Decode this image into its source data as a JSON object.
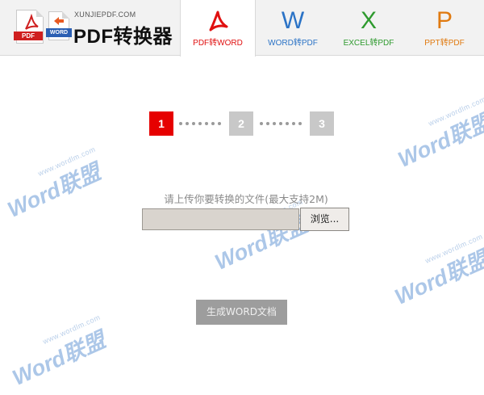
{
  "logo": {
    "small_text": "XUNJIEPDF.COM",
    "title": "PDF转换器",
    "pdf_tag": "PDF",
    "word_tag": "WORD"
  },
  "tabs": [
    {
      "label": "PDF转WORD",
      "icon": "pdf-icon",
      "glyph": "",
      "color": "#e01010",
      "active": true
    },
    {
      "label": "WORD转PDF",
      "icon": "word-icon",
      "glyph": "W",
      "color": "#2b73c6",
      "active": false
    },
    {
      "label": "EXCEL转PDF",
      "icon": "excel-icon",
      "glyph": "X",
      "color": "#2e9a2e",
      "active": false
    },
    {
      "label": "PPT转PDF",
      "icon": "ppt-icon",
      "glyph": "P",
      "color": "#e07a10",
      "active": false
    }
  ],
  "steps": [
    {
      "label": "1",
      "active": true,
      "color": "#e60000"
    },
    {
      "label": "2",
      "active": false,
      "color": "#c8c8c8"
    },
    {
      "label": "3",
      "active": false,
      "color": "#c8c8c8"
    }
  ],
  "upload": {
    "hint": "请上传你要转换的文件(最大支持2M)",
    "file_value": "",
    "browse_label": "浏览..."
  },
  "generate_label": "生成WORD文档",
  "watermark": {
    "url": "www.wordlm.com",
    "text": "Word联盟"
  }
}
